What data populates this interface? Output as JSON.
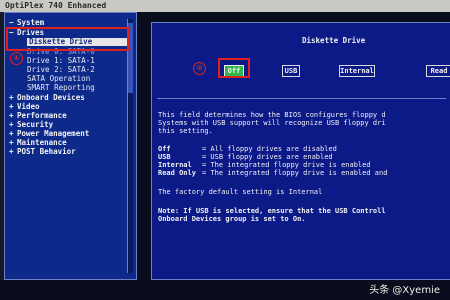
{
  "window": {
    "title": "OptiPlex 740 Enhanced"
  },
  "nav": {
    "items": [
      {
        "sign": "−",
        "label": "System"
      },
      {
        "sign": "−",
        "label": "Drives"
      },
      {
        "sign": "",
        "label": "Diskette Drive",
        "selected": true
      },
      {
        "sign": "",
        "label": "Drive 0: SATA-0"
      },
      {
        "sign": "",
        "label": "Drive 1: SATA-1"
      },
      {
        "sign": "",
        "label": "Drive 2: SATA-2"
      },
      {
        "sign": "",
        "label": "SATA Operation"
      },
      {
        "sign": "",
        "label": "SMART Reporting"
      },
      {
        "sign": "+",
        "label": "Onboard Devices"
      },
      {
        "sign": "+",
        "label": "Video"
      },
      {
        "sign": "+",
        "label": "Performance"
      },
      {
        "sign": "+",
        "label": "Security"
      },
      {
        "sign": "+",
        "label": "Power Management"
      },
      {
        "sign": "+",
        "label": "Maintenance"
      },
      {
        "sign": "+",
        "label": "POST Behavior"
      }
    ]
  },
  "annotations": {
    "one": "①",
    "two": "②"
  },
  "content": {
    "title": "Diskette Drive",
    "options": [
      "Off",
      "USB",
      "Internal",
      "Read"
    ],
    "active_option": "Off",
    "description": [
      "This field determines how the BIOS configures floppy d",
      "Systems with USB support will recognize USB floppy dri",
      "this setting."
    ],
    "definitions": [
      {
        "term": "Off",
        "text": "= All floppy drives are disabled"
      },
      {
        "term": "USB",
        "text": "= USB floppy drives are enabled"
      },
      {
        "term": "Internal",
        "text": "= The integrated floppy drive is enabled"
      },
      {
        "term": "Read Only",
        "text": "= The integrated floppy drive is enabled and"
      }
    ],
    "factory_default": "The factory default setting is Internal",
    "note": [
      "Note: If USB is selected, ensure that the USB Controll",
      "Onboard Devices group is set to On."
    ]
  },
  "watermark": "头条 @Xyemie",
  "colors": {
    "nav_bg": "#0d2a8a",
    "content_bg": "#0c1a88",
    "active_option": "#2eb84a",
    "annotation": "#e02020"
  }
}
